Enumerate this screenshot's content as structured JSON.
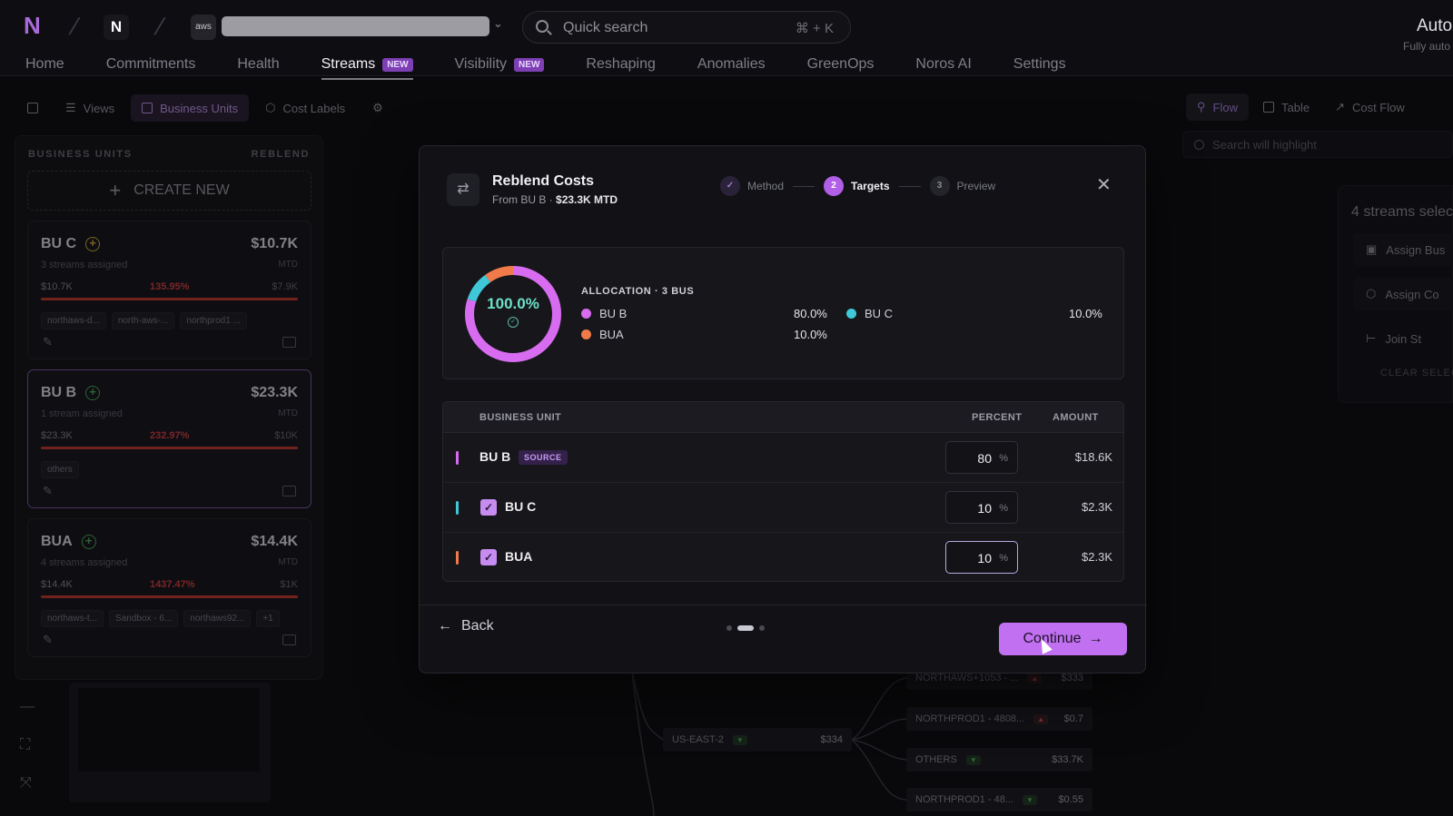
{
  "topbar": {
    "org_initial": "N",
    "cloud_label": "aws",
    "search_placeholder": "Quick search",
    "search_shortcut": "⌘ + K",
    "right_title": "Auto",
    "right_subtitle": "Fully auto"
  },
  "nav": {
    "items": [
      {
        "label": "Home"
      },
      {
        "label": "Commitments"
      },
      {
        "label": "Health"
      },
      {
        "label": "Streams",
        "badge": "NEW",
        "active": true
      },
      {
        "label": "Visibility",
        "badge": "NEW"
      },
      {
        "label": "Reshaping"
      },
      {
        "label": "Anomalies"
      },
      {
        "label": "GreenOps"
      },
      {
        "label": "Noros AI"
      },
      {
        "label": "Settings"
      }
    ]
  },
  "toolbar": {
    "views": "Views",
    "business_units": "Business Units",
    "cost_labels": "Cost Labels",
    "flow": "Flow",
    "table": "Table",
    "cost_flow": "Cost Flow",
    "highlight_placeholder": "Search will highlight"
  },
  "left_panel": {
    "heading": "BUSINESS UNITS",
    "reblend": "REBLEND",
    "create_new": "CREATE NEW",
    "cards": [
      {
        "name": "BU C",
        "amount": "$10.7K",
        "sub": "3 streams assigned",
        "mtd": "MTD",
        "spent": "$10.7K",
        "pct": "135.95%",
        "budget": "$7.9K",
        "chips": [
          "northaws-d...",
          "north-aws-...",
          "northprod1 ..."
        ],
        "accent": "#d8b03a"
      },
      {
        "name": "BU B",
        "amount": "$23.3K",
        "sub": "1 stream assigned",
        "mtd": "MTD",
        "spent": "$23.3K",
        "pct": "232.97%",
        "budget": "$10K",
        "chips": [
          "others"
        ],
        "accent": "#4fae5a"
      },
      {
        "name": "BUA",
        "amount": "$14.4K",
        "sub": "4 streams assigned",
        "mtd": "MTD",
        "spent": "$14.4K",
        "pct": "1437.47%",
        "budget": "$1K",
        "chips": [
          "northaws-t...",
          "Sandbox - 6...",
          "northaws92...",
          "+1"
        ],
        "accent": "#4fae5a"
      }
    ]
  },
  "flow": {
    "nodes": [
      {
        "label": "NORTHAWS+1053 - ...",
        "value": "$333"
      },
      {
        "label": "NORTHPROD1 - 4808...",
        "value": "$0.7"
      },
      {
        "label": "US-EAST-2",
        "value": "$334"
      },
      {
        "label": "OTHERS",
        "value": "$33.7K"
      },
      {
        "label": "NORTHPROD1 - 48...",
        "value": "$0.55"
      }
    ]
  },
  "streams_panel": {
    "title": "4 streams selec",
    "assign_bu": "Assign Bus",
    "assign_cost": "Assign Co",
    "join": "Join St",
    "clear": "CLEAR SELEC"
  },
  "modal": {
    "title": "Reblend Costs",
    "from_prefix": "From BU B · ",
    "from_amount": "$23.3K MTD",
    "steps": [
      {
        "num": "✓",
        "label": "Method",
        "state": "done"
      },
      {
        "num": "2",
        "label": "Targets",
        "state": "active"
      },
      {
        "num": "3",
        "label": "Preview",
        "state": "todo"
      }
    ],
    "allocation": {
      "total": "100.0%",
      "heading": "ALLOCATION · 3 BUS",
      "legend": [
        {
          "name": "BU B",
          "pct": "80.0%",
          "color": "#d86cf0"
        },
        {
          "name": "BUA",
          "pct": "10.0%",
          "color": "#f07a4a"
        },
        {
          "name": "BU C",
          "pct": "10.0%",
          "color": "#3ec8d8"
        }
      ]
    },
    "table": {
      "col_bu": "BUSINESS UNIT",
      "col_pct": "PERCENT",
      "col_amt": "AMOUNT",
      "source_badge": "SOURCE",
      "rows": [
        {
          "name": "BU B",
          "percent": "80",
          "unit": "%",
          "amount": "$18.6K",
          "color": "#d86cf0"
        },
        {
          "name": "BU C",
          "percent": "10",
          "unit": "%",
          "amount": "$2.3K",
          "color": "#3ec8d8"
        },
        {
          "name": "BUA",
          "percent": "10",
          "unit": "%",
          "amount": "$2.3K",
          "color": "#f07a4a"
        }
      ]
    },
    "back": "Back",
    "continue": "Continue"
  }
}
